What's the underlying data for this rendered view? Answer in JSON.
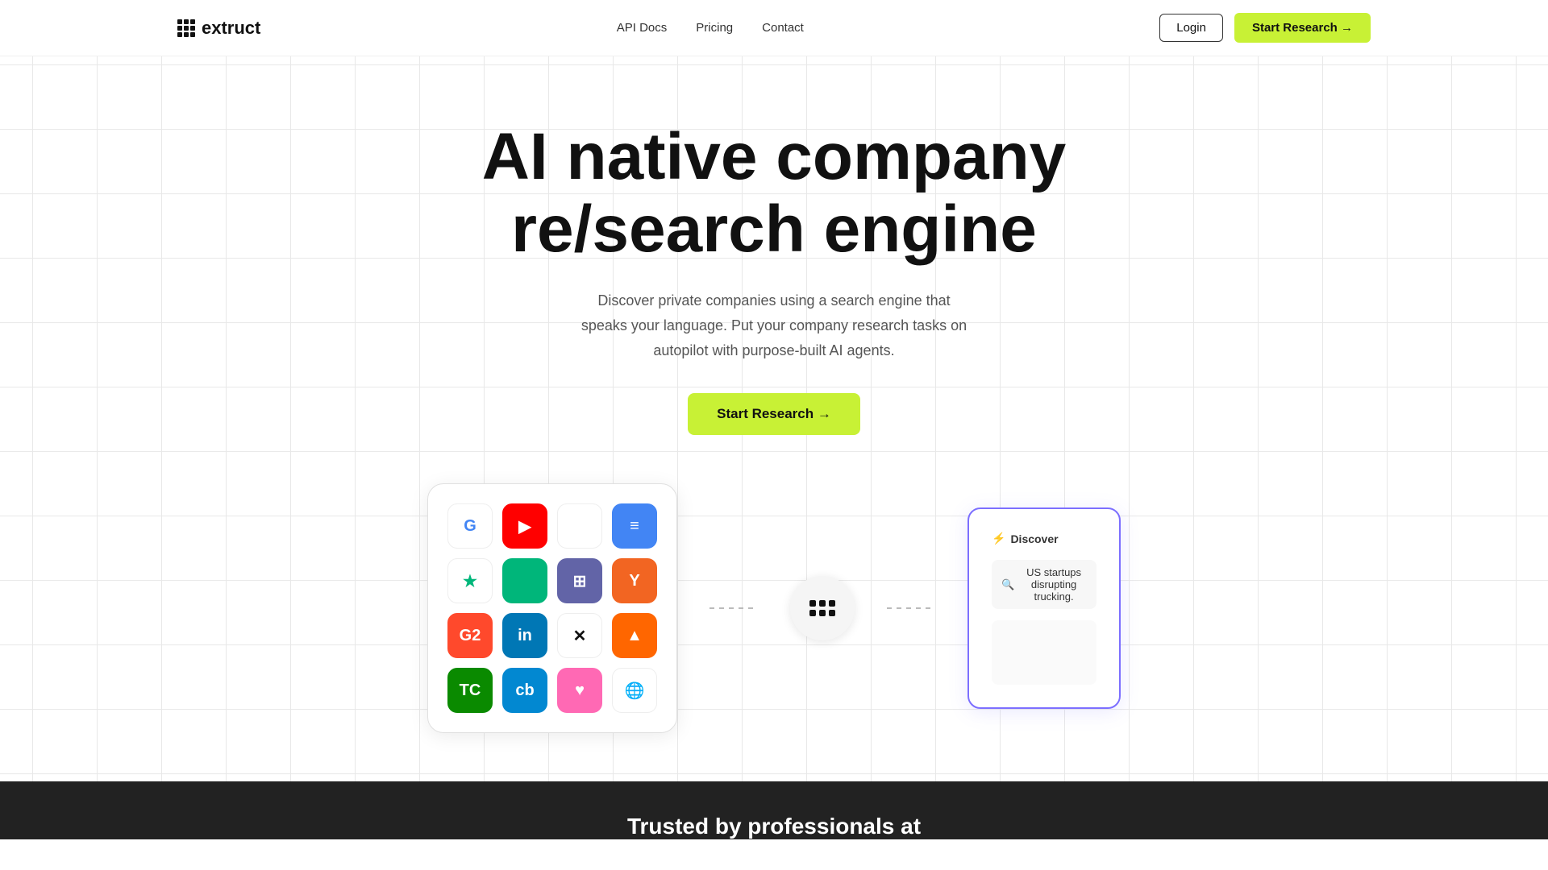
{
  "brand": {
    "name": "extruct"
  },
  "nav": {
    "links": [
      {
        "label": "API Docs",
        "href": "#"
      },
      {
        "label": "Pricing",
        "href": "#"
      },
      {
        "label": "Contact",
        "href": "#"
      }
    ],
    "login_label": "Login",
    "start_research_label": "Start Research →"
  },
  "hero": {
    "title_line1": "AI native company",
    "title_line2": "re/search engine",
    "subtitle": "Discover private companies using a search engine that speaks your language. Put your company research tasks on autopilot with purpose-built AI agents.",
    "cta_label": "Start Research →"
  },
  "discover_card": {
    "header": "Discover",
    "query": "US startups disrupting trucking."
  },
  "integration_icons": [
    {
      "label": "G",
      "bg": "#fff",
      "color": "#4285F4",
      "border": "#eee"
    },
    {
      "label": "▶",
      "bg": "#FF0000",
      "color": "#fff",
      "border": "#FF0000"
    },
    {
      "label": "",
      "bg": "#fff",
      "color": "#222",
      "border": "#eee"
    },
    {
      "label": "≡",
      "bg": "#4285F4",
      "color": "#fff",
      "border": "#4285F4"
    },
    {
      "label": "★",
      "bg": "#fff",
      "color": "#00b67a",
      "border": "#eee"
    },
    {
      "label": "",
      "bg": "#00b67a",
      "color": "#fff",
      "border": "#00b67a"
    },
    {
      "label": "⊞",
      "bg": "#6264a7",
      "color": "#fff",
      "border": "#6264a7"
    },
    {
      "label": "Y",
      "bg": "#f26522",
      "color": "#fff",
      "border": "#f26522"
    },
    {
      "label": "G2",
      "bg": "#ff492c",
      "color": "#fff",
      "border": "#ff492c"
    },
    {
      "label": "in",
      "bg": "#0077B5",
      "color": "#fff",
      "border": "#0077B5"
    },
    {
      "label": "✕",
      "bg": "#fff",
      "color": "#111",
      "border": "#eee"
    },
    {
      "label": "▲",
      "bg": "#ff6600",
      "color": "#fff",
      "border": "#ff6600"
    },
    {
      "label": "TC",
      "bg": "#0a8a00",
      "color": "#fff",
      "border": "#0a8a00"
    },
    {
      "label": "cb",
      "bg": "#0288D1",
      "color": "#fff",
      "border": "#0288D1"
    },
    {
      "label": "♥",
      "bg": "#ff69b4",
      "color": "#fff",
      "border": "#ff69b4"
    },
    {
      "label": "🌐",
      "bg": "#fff",
      "color": "#333",
      "border": "#eee"
    }
  ],
  "footer": {
    "trusted_text": "Trusted by professionals at"
  }
}
